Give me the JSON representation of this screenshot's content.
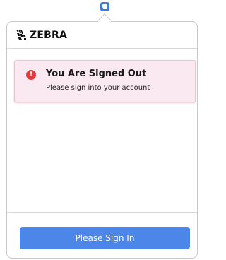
{
  "toolbar": {
    "extension_icon": "device-monitor-icon"
  },
  "header": {
    "brand": "ZEBRA",
    "logo_icon": "zebra-head-logo"
  },
  "alert": {
    "icon": "exclamation-icon",
    "title": "You Are Signed Out",
    "message": "Please sign into your account",
    "status_color": "#e23b3b",
    "background": "#fbe9f1"
  },
  "actions": {
    "sign_in_label": "Please Sign In",
    "accent": "#4b86e8"
  }
}
